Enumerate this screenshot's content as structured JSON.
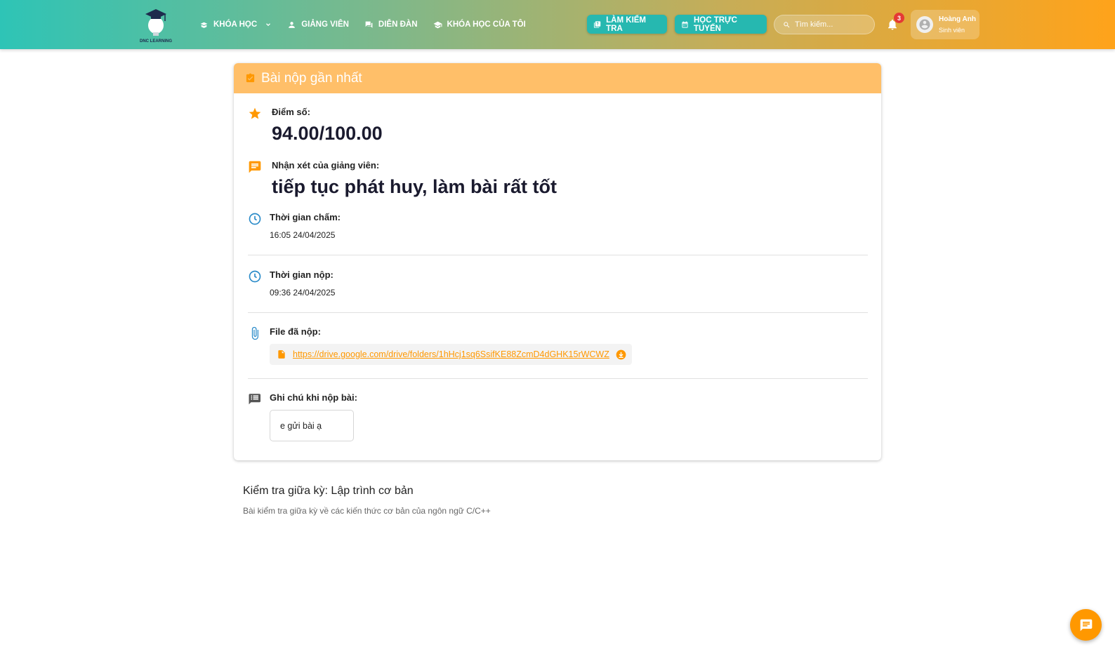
{
  "header": {
    "logo_text": "DNC LEARNING",
    "nav": [
      {
        "label": "KHÓA HỌC",
        "icon": "book-open-icon"
      },
      {
        "label": "GIẢNG VIÊN",
        "icon": "person-icon"
      },
      {
        "label": "DIỄN ĐÀN",
        "icon": "forum-icon"
      },
      {
        "label": "KHÓA HỌC CỦA TÔI",
        "icon": "graduation-cap-icon"
      }
    ],
    "btn_test": "LÀM KIỂM TRA",
    "btn_online": "HỌC TRỰC TUYẾN",
    "search_placeholder": "Tìm kiếm...",
    "notification_count": "3",
    "user": {
      "name": "Hoàng Anh",
      "role": "Sinh viên"
    }
  },
  "submission": {
    "title": "Bài nộp gần nhất",
    "score_label": "Điểm số:",
    "score_value": "94.00/100.00",
    "comment_label": "Nhận xét của giảng viên:",
    "comment_value": "tiếp tục phát huy, làm bài rất tốt",
    "graded_label": "Thời gian chấm:",
    "graded_value": "16:05 24/04/2025",
    "submitted_label": "Thời gian nộp:",
    "submitted_value": "09:36 24/04/2025",
    "file_label": "File đã nộp:",
    "file_url": "https://drive.google.com/drive/folders/1hHcj1sq6SsifKE88ZcmD4dGHK15rWCWZ",
    "note_label": "Ghi chú khi nộp bài:",
    "note_value": "e gửi bài ạ"
  },
  "exam": {
    "title": "Kiểm tra giữa kỳ: Lập trình cơ bản",
    "description": "Bài kiểm tra giữa kỳ về các kiến thức cơ bản của ngôn ngữ C/C++"
  },
  "colors": {
    "accent": "#ff9800",
    "teal": "#26b8b0",
    "header_light": "#ffbf69"
  }
}
